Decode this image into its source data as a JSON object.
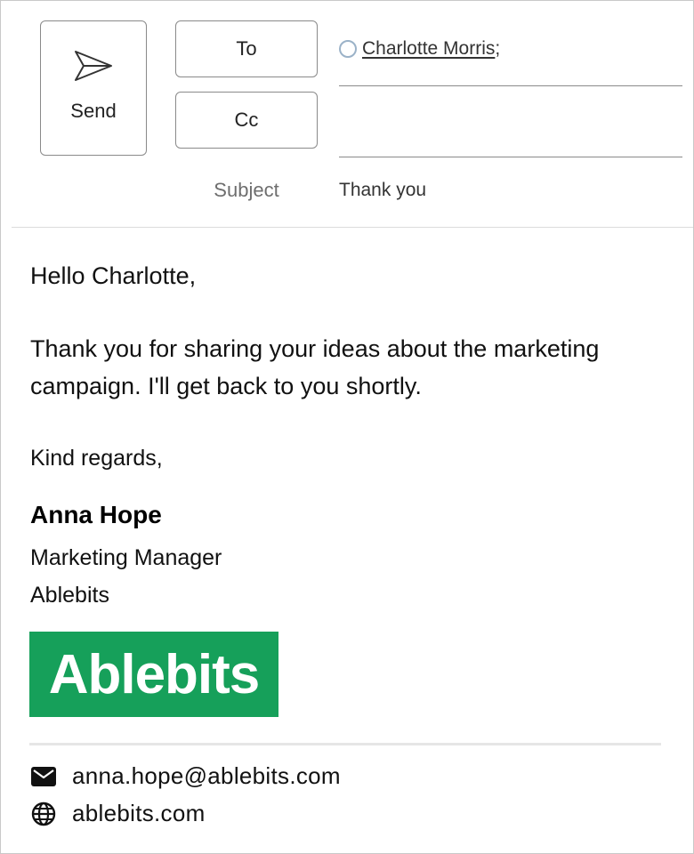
{
  "compose": {
    "send_label": "Send",
    "to_label": "To",
    "cc_label": "Cc",
    "subject_label": "Subject",
    "to_recipients": [
      {
        "name": "Charlotte Morris",
        "separator": ";"
      }
    ],
    "cc_value": "",
    "subject_value": "Thank you"
  },
  "message": {
    "greeting": "Hello Charlotte,",
    "body": "Thank you for sharing your ideas about the marketing campaign. I'll get back to you shortly.",
    "closing": "Kind regards,"
  },
  "signature": {
    "name": "Anna Hope",
    "title": "Marketing Manager",
    "company": "Ablebits",
    "logo_text": "Ablebits",
    "logo_color": "#16a05a",
    "email": "anna.hope@ablebits.com",
    "website": "ablebits.com",
    "email_icon": "envelope-icon",
    "website_icon": "globe-icon"
  }
}
